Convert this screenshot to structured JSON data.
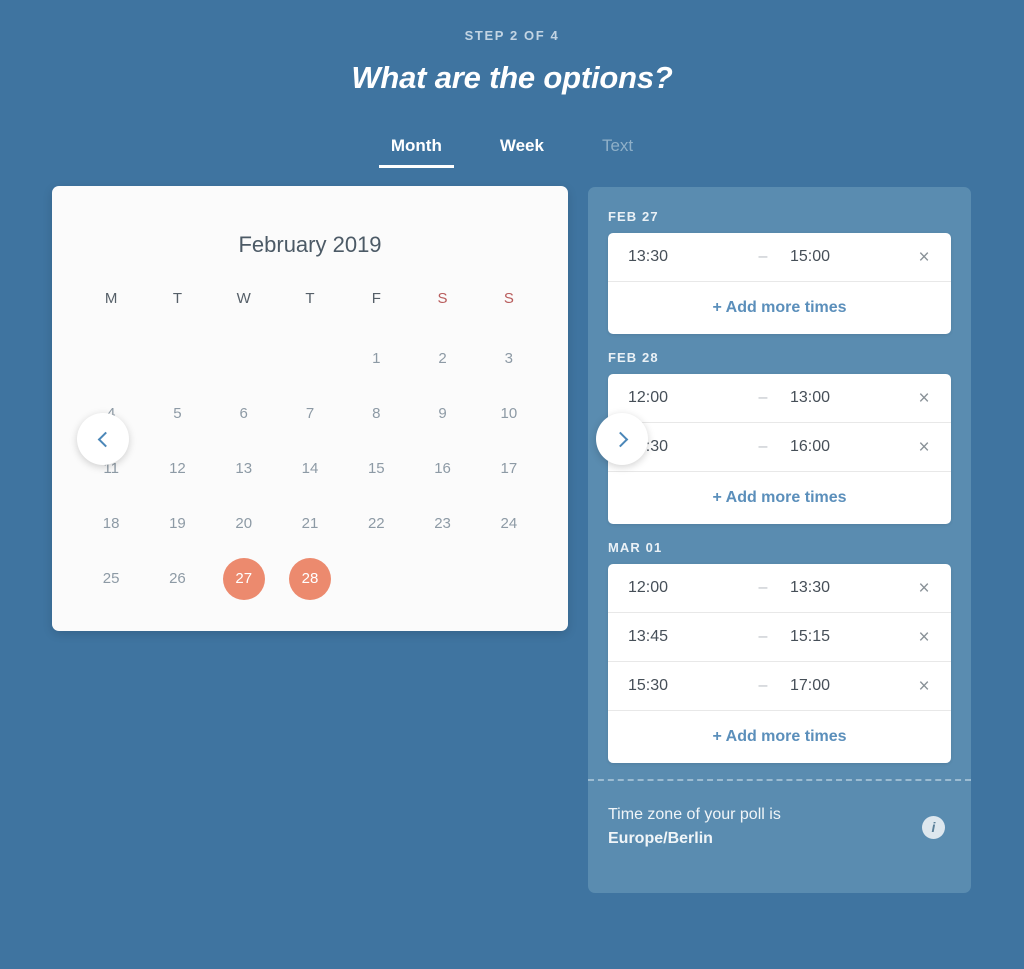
{
  "header": {
    "step_label": "STEP 2 OF 4",
    "title": "What are the options?"
  },
  "tabs": [
    {
      "label": "Month",
      "state": "active"
    },
    {
      "label": "Week",
      "state": "normal"
    },
    {
      "label": "Text",
      "state": "muted"
    }
  ],
  "calendar": {
    "title": "February 2019",
    "prev_icon": "chevron-left-icon",
    "next_icon": "chevron-right-icon",
    "weekdays": [
      {
        "label": "M",
        "weekend": false
      },
      {
        "label": "T",
        "weekend": false
      },
      {
        "label": "W",
        "weekend": false
      },
      {
        "label": "T",
        "weekend": false
      },
      {
        "label": "F",
        "weekend": false
      },
      {
        "label": "S",
        "weekend": true
      },
      {
        "label": "S",
        "weekend": true
      }
    ],
    "leading_blanks": 4,
    "days": [
      {
        "n": "1"
      },
      {
        "n": "2"
      },
      {
        "n": "3"
      },
      {
        "n": "4"
      },
      {
        "n": "5"
      },
      {
        "n": "6"
      },
      {
        "n": "7"
      },
      {
        "n": "8"
      },
      {
        "n": "9"
      },
      {
        "n": "10"
      },
      {
        "n": "11"
      },
      {
        "n": "12"
      },
      {
        "n": "13"
      },
      {
        "n": "14"
      },
      {
        "n": "15"
      },
      {
        "n": "16"
      },
      {
        "n": "17"
      },
      {
        "n": "18"
      },
      {
        "n": "19"
      },
      {
        "n": "20"
      },
      {
        "n": "21"
      },
      {
        "n": "22"
      },
      {
        "n": "23"
      },
      {
        "n": "24"
      },
      {
        "n": "25"
      },
      {
        "n": "26"
      },
      {
        "n": "27",
        "selected": true
      },
      {
        "n": "28",
        "selected": true
      }
    ]
  },
  "slots_panel": {
    "add_label": "+ Add more times",
    "remove_icon": "close-icon",
    "dash": "–",
    "days": [
      {
        "label": "FEB 27",
        "slots": [
          {
            "start": "13:30",
            "end": "15:00"
          }
        ]
      },
      {
        "label": "FEB 28",
        "slots": [
          {
            "start": "12:00",
            "end": "13:00"
          },
          {
            "start": "14:30",
            "end": "16:00"
          }
        ]
      },
      {
        "label": "MAR 01",
        "slots": [
          {
            "start": "12:00",
            "end": "13:30"
          },
          {
            "start": "13:45",
            "end": "15:15"
          },
          {
            "start": "15:30",
            "end": "17:00"
          }
        ]
      }
    ],
    "timezone": {
      "line1": "Time zone of your poll is",
      "line2": "Europe/Berlin",
      "info_icon": "info-icon",
      "info_glyph": "i"
    }
  },
  "colors": {
    "background": "#3f74a0",
    "panel": "#5a8cb0",
    "accent_selected": "#ec8a6e",
    "link": "#5b8fbb",
    "weekend": "#b85c5c",
    "card": "#ffffff"
  }
}
